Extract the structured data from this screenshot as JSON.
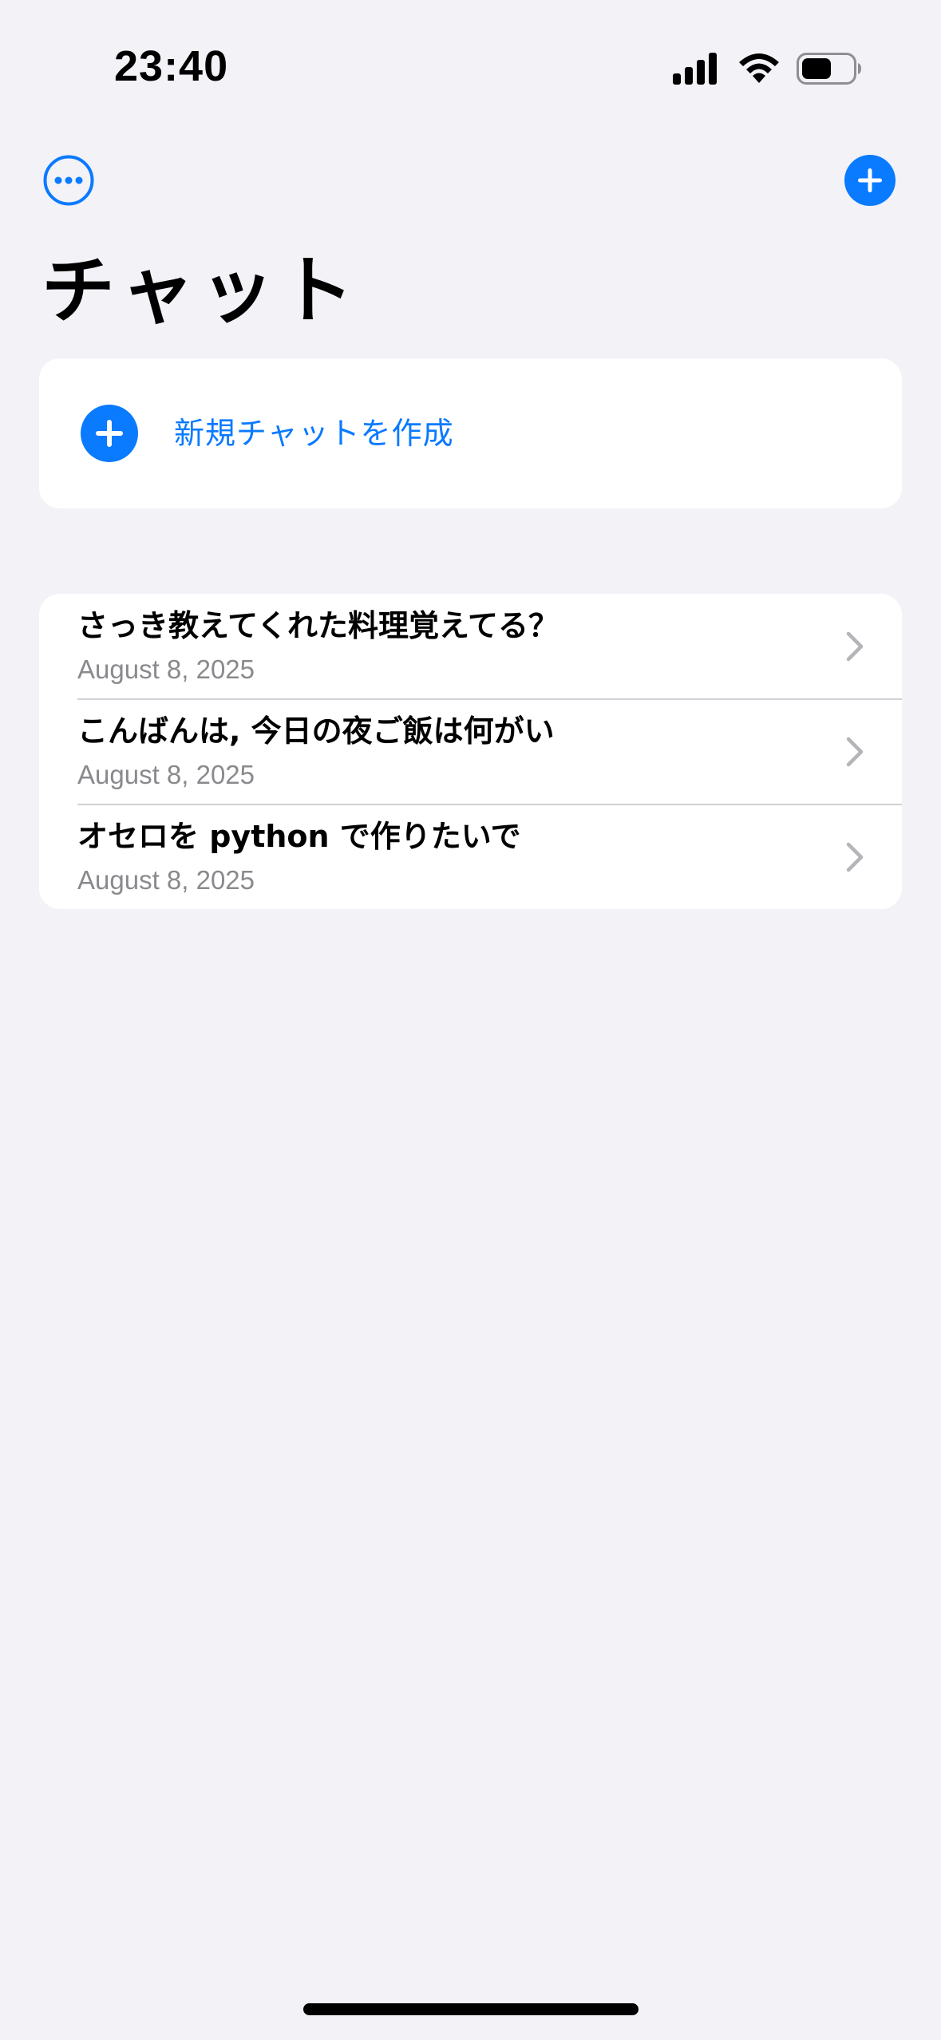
{
  "status_bar": {
    "time": "23:40"
  },
  "colors": {
    "accent": "#0a7aff",
    "background": "#f2f2f7",
    "secondary_text": "#8a8a8e"
  },
  "nav": {
    "more_icon": "ellipsis-circle-icon",
    "add_icon": "plus-circle-fill-icon"
  },
  "page_title": "チャット",
  "new_chat": {
    "icon": "plus-circle-fill-icon",
    "label": "新規チャットを作成"
  },
  "chats": [
    {
      "title": "さっき教えてくれた料理覚えてる？",
      "date": "August 8, 2025"
    },
    {
      "title": "こんばんは,  今日の夜ご飯は何がい",
      "date": "August 8, 2025"
    },
    {
      "title": "オセロを python で作りたいで",
      "date": "August 8, 2025"
    }
  ]
}
